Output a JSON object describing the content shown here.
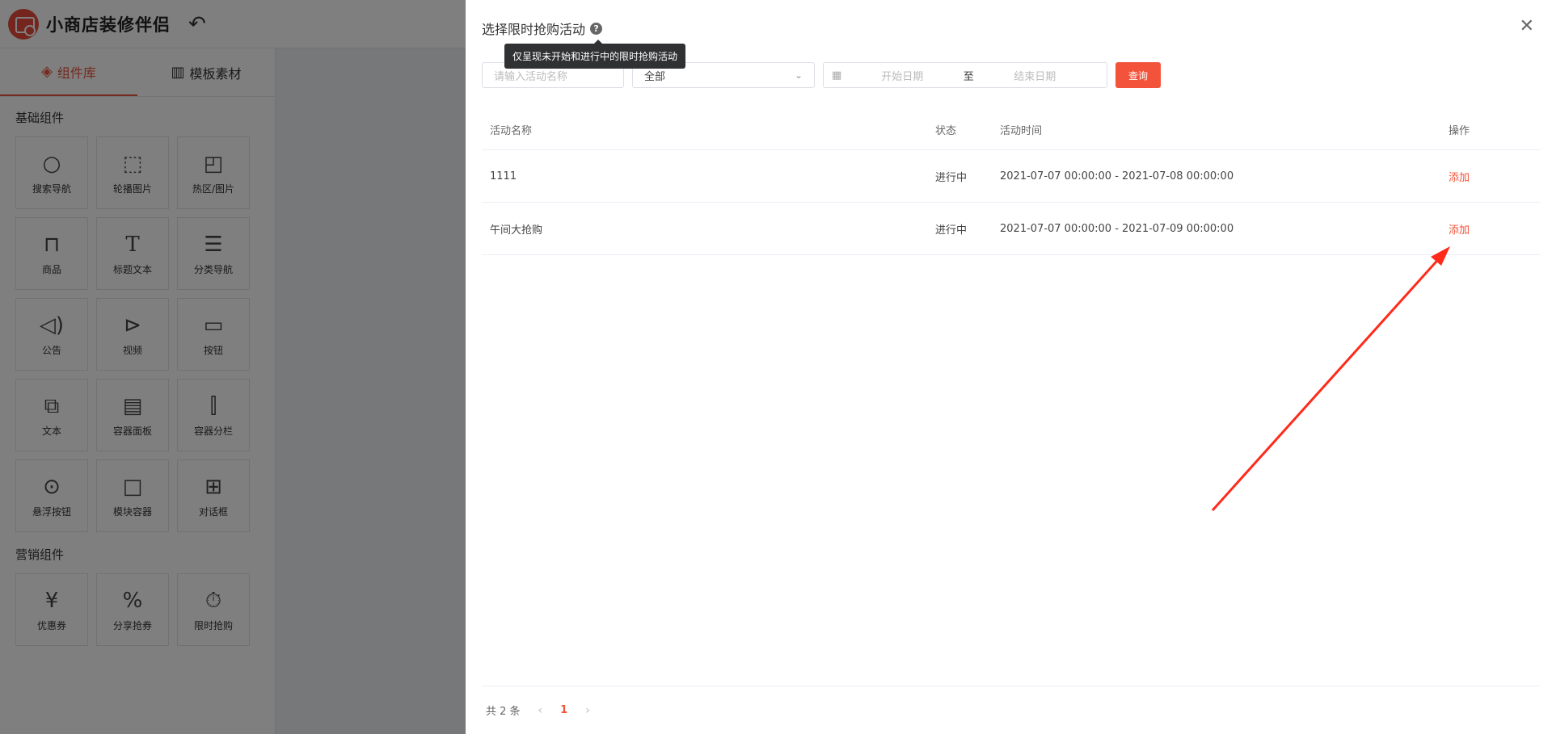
{
  "app": {
    "title": "小商店装修伴侣",
    "side_tabs": [
      {
        "label": "组件库",
        "active": true
      },
      {
        "label": "模板素材",
        "active": false
      }
    ],
    "sections": [
      {
        "title": "基础组件",
        "items": [
          {
            "label": "搜索导航",
            "icon": "search-icon"
          },
          {
            "label": "轮播图片",
            "icon": "carousel-icon"
          },
          {
            "label": "热区/图片",
            "icon": "hotspot-icon"
          },
          {
            "label": "商品",
            "icon": "bag-icon"
          },
          {
            "label": "标题文本",
            "icon": "title-text-icon"
          },
          {
            "label": "分类导航",
            "icon": "list-icon"
          },
          {
            "label": "公告",
            "icon": "speaker-icon"
          },
          {
            "label": "视频",
            "icon": "play-icon"
          },
          {
            "label": "按钮",
            "icon": "button-icon"
          },
          {
            "label": "文本",
            "icon": "text-icon"
          },
          {
            "label": "容器面板",
            "icon": "panel-icon"
          },
          {
            "label": "容器分栏",
            "icon": "columns-icon"
          },
          {
            "label": "悬浮按钮",
            "icon": "float-button-icon"
          },
          {
            "label": "模块容器",
            "icon": "module-icon"
          },
          {
            "label": "对话框",
            "icon": "dialog-icon"
          }
        ]
      },
      {
        "title": "营销组件",
        "items": [
          {
            "label": "优惠券",
            "icon": "coupon-icon"
          },
          {
            "label": "分享抢券",
            "icon": "share-coupon-icon"
          },
          {
            "label": "限时抢购",
            "icon": "flash-sale-icon"
          }
        ]
      }
    ]
  },
  "drawer": {
    "title": "选择限时抢购活动",
    "tooltip": "仅呈现未开始和进行中的限时抢购活动",
    "filters": {
      "name_placeholder": "请输入活动名称",
      "status_value": "全部",
      "date_start_placeholder": "开始日期",
      "date_separator": "至",
      "date_end_placeholder": "结束日期",
      "query_label": "查询"
    },
    "table": {
      "columns": [
        "活动名称",
        "状态",
        "活动时间",
        "操作"
      ],
      "rows": [
        {
          "name": "1111",
          "status": "进行中",
          "time": "2021-07-07 00:00:00 - 2021-07-08 00:00:00",
          "action": "添加"
        },
        {
          "name": "午间大抢购",
          "status": "进行中",
          "time": "2021-07-07 00:00:00 - 2021-07-09 00:00:00",
          "action": "添加"
        }
      ]
    },
    "pagination": {
      "total_text": "共 2 条",
      "current_page": "1"
    }
  },
  "colors": {
    "accent": "#f4533b",
    "annotation_arrow": "#ff2a1a"
  }
}
